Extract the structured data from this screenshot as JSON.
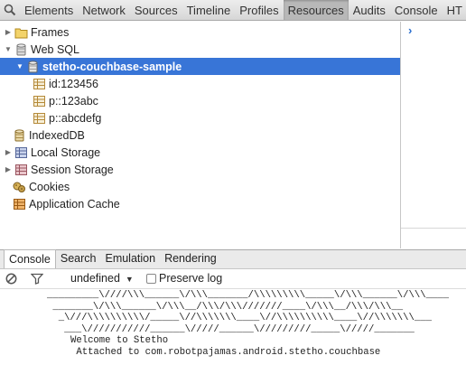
{
  "toolbar": {
    "search_icon": "magnifier",
    "tabs": [
      "Elements",
      "Network",
      "Sources",
      "Timeline",
      "Profiles",
      "Resources",
      "Audits",
      "Console",
      "HT"
    ],
    "active_tab": "Resources"
  },
  "tree": {
    "frames": "Frames",
    "web_sql": "Web SQL",
    "database": "stetho-couchbase-sample",
    "tables": [
      "id:123456",
      "p::123abc",
      "p::abcdefg"
    ],
    "indexeddb": "IndexedDB",
    "local_storage": "Local Storage",
    "session_storage": "Session Storage",
    "cookies": "Cookies",
    "app_cache": "Application Cache"
  },
  "side_panel": {
    "chevron": "›"
  },
  "drawer": {
    "tabs": [
      "Console",
      "Search",
      "Emulation",
      "Rendering"
    ],
    "active_tab": "Console"
  },
  "console_toolbar": {
    "context": "undefined",
    "preserve_log_label": "Preserve log",
    "preserve_log_checked": false
  },
  "console": {
    "ascii_lines": [
      "_________\\////\\\\\\______\\/\\\\\\_______/\\\\\\\\\\\\\\\\\\_____\\/\\\\\\______\\/\\\\\\____",
      " _______\\/\\\\\\______\\/\\\\\\__/\\\\\\/\\\\\\///////____\\/\\\\\\__/\\\\\\/\\\\\\__",
      "  _\\///\\\\\\\\\\\\\\\\\\\\/_____\\//\\\\\\\\\\\\\\____\\//\\\\\\\\\\\\\\\\\\\\____\\//\\\\\\\\\\\\\\___",
      "   ___\\///////////______\\/////______\\/////////_____\\/////_______"
    ],
    "welcome": "Welcome to Stetho",
    "attached": " Attached to com.robotpajamas.android.stetho.couchbase"
  }
}
